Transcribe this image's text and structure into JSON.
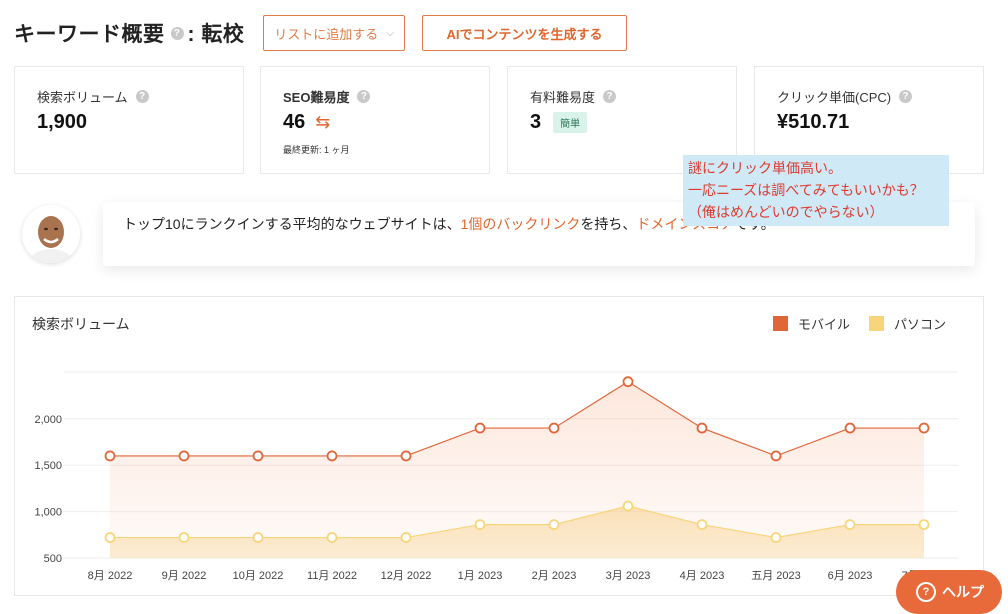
{
  "header": {
    "title": "キーワード概要",
    "keyword": ": 転校",
    "help_icon": "?",
    "list_button": "リストに追加する",
    "ai_button": "AIでコンテンツを生成する"
  },
  "cards": [
    {
      "label": "検索ボリューム",
      "value": "1,900"
    },
    {
      "label": "SEO難易度",
      "value": "46",
      "sub": "最終更新: 1 ヶ月"
    },
    {
      "label": "有料難易度",
      "value": "3",
      "badge": "簡単"
    },
    {
      "label": "クリック単価(CPC)",
      "value": "¥510.71"
    }
  ],
  "tip": {
    "pre": "トップ10にランクインする平均的なウェブサイトは、",
    "link1": "1個のバックリンク",
    "mid": "を持ち、",
    "link2": "ドメインスコア",
    "tail": "です。"
  },
  "note": {
    "line1": "謎にクリック単価高い。",
    "line2": "一応ニーズは調べてみてもいいかも？",
    "line3": "（俺はめんどいのでやらない）"
  },
  "help_label": "ヘルプ",
  "icons": {
    "avatar": "person-avatar",
    "refresh": "refresh-icon",
    "help": "question-icon",
    "chevron": "chevron-down-icon"
  },
  "colors": {
    "accent": "#e0662e",
    "mobile": "#e0663a",
    "desktop": "#f7d57a",
    "badge_bg": "#d9f3ea"
  },
  "chart_data": {
    "type": "area",
    "title": "検索ボリューム",
    "categories": [
      "8月 2022",
      "9月 2022",
      "10月 2022",
      "11月 2022",
      "12月 2022",
      "1月 2023",
      "2月 2023",
      "3月 2023",
      "4月 2023",
      "五月 2023",
      "6月 2023",
      "7月 2023"
    ],
    "series": [
      {
        "name": "モバイル",
        "values": [
          1600,
          1600,
          1600,
          1600,
          1600,
          1900,
          1900,
          2400,
          1900,
          1600,
          1900,
          1900
        ]
      },
      {
        "name": "パソコン",
        "values": [
          720,
          720,
          720,
          720,
          720,
          860,
          860,
          1060,
          860,
          720,
          860,
          860
        ]
      }
    ],
    "yticks": [
      "500",
      "1,000",
      "1,500",
      "2,000"
    ],
    "ylim": [
      500,
      2500
    ],
    "grid": true,
    "legend": "top-right"
  }
}
